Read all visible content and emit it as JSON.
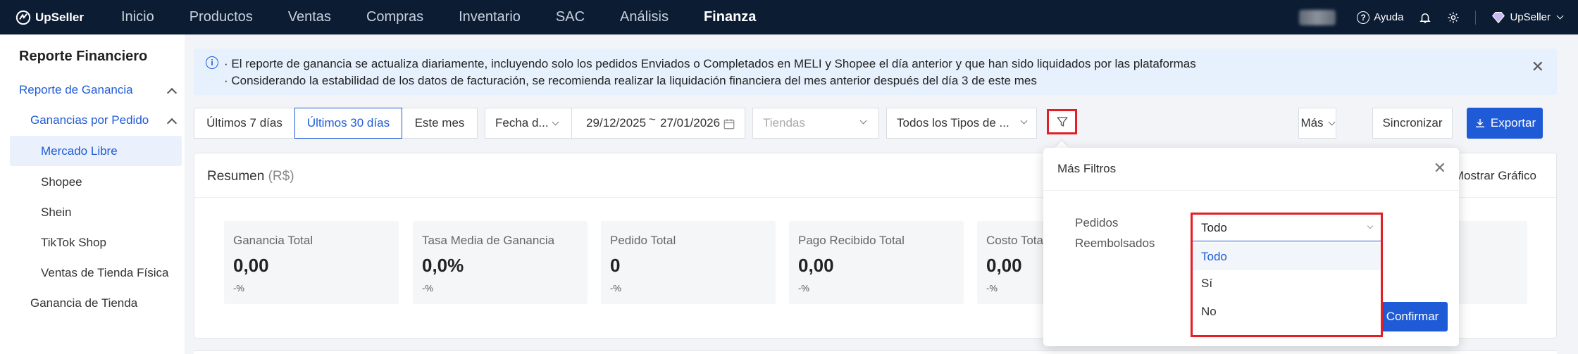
{
  "app": {
    "name": "UpSeller"
  },
  "nav": {
    "items": [
      "Inicio",
      "Productos",
      "Ventas",
      "Compras",
      "Inventario",
      "SAC",
      "Análisis",
      "Finanza"
    ],
    "active": "Finanza",
    "help_label": "Ayuda",
    "user_label": "UpSeller"
  },
  "sidebar": {
    "title": "Reporte Financiero",
    "group": "Reporte de Ganancia",
    "subgroup": "Ganancias por Pedido",
    "items": [
      "Mercado Libre",
      "Shopee",
      "Shein",
      "TikTok Shop",
      "Ventas de Tienda Física"
    ],
    "selected": "Mercado Libre",
    "bottom_item": "Ganancia de Tienda"
  },
  "banner": {
    "line1": "· El reporte de ganancia se actualiza diariamente, incluyendo solo los pedidos Enviados o Completados en MELI y Shopee el día anterior y que han sido liquidados por las plataformas",
    "line2": "· Considerando la estabilidad de los datos de facturación, se recomienda realizar la liquidación financiera del mes anterior después del día 3 de este mes"
  },
  "filters": {
    "range_tabs": [
      "Últimos 7 días",
      "Últimos 30 días",
      "Este mes"
    ],
    "active_range": "Últimos 30 días",
    "date_type": "Fecha d...",
    "date_start": "29/12/2025",
    "date_sep": "~",
    "date_end": "27/01/2026",
    "stores_placeholder": "Tiendas",
    "types_value": "Todos los Tipos de ...",
    "more_label": "Más",
    "sync_label": "Sincronizar",
    "export_label": "Exportar"
  },
  "summary": {
    "title": "Resumen",
    "currency": "(R$)",
    "show_graph_label": "Mostrar Gráfico",
    "cards": [
      {
        "label": "Ganancia Total",
        "value": "0,00",
        "change": "-%"
      },
      {
        "label": "Tasa Media de Ganancia",
        "value": "0,0%",
        "change": "-%"
      },
      {
        "label": "Pedido Total",
        "value": "0",
        "change": "-%"
      },
      {
        "label": "Pago Recibido Total",
        "value": "0,00",
        "change": "-%"
      },
      {
        "label": "Costo Total",
        "value": "0,00",
        "change": "-%"
      }
    ]
  },
  "more_filters": {
    "title": "Más Filtros",
    "refund_label_line1": "Pedidos",
    "refund_label_line2": "Reembolsados",
    "selected_value": "Todo",
    "options": [
      "Todo",
      "Sí",
      "No"
    ],
    "confirm_label": "Confirmar"
  },
  "colors": {
    "primary": "#1f5bd6",
    "nav_bg": "#0c1c33",
    "highlight": "#e31e24"
  }
}
